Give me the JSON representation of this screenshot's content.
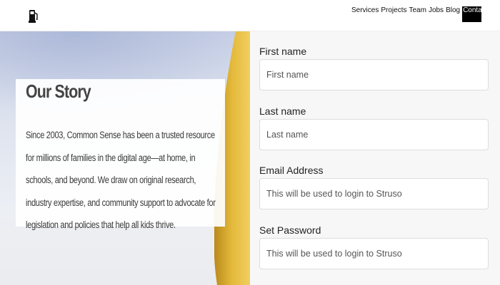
{
  "header": {
    "logo_icon": "fuel-pump-icon",
    "nav": [
      "Services",
      "Projects",
      "Team",
      "Jobs",
      "Blog",
      "Contact"
    ],
    "active_nav": "Contact"
  },
  "story": {
    "title": "Our Story",
    "body": "Since 2003, Common Sense has been a trusted resource for millions of families in the digital age—at home, in schools, and beyond. We draw on original research, industry expertise, and community support to advocate for legislation and policies that help all kids thrive."
  },
  "form": {
    "first_name": {
      "label": "First name",
      "placeholder": "First name"
    },
    "last_name": {
      "label": "Last name",
      "placeholder": "Last name"
    },
    "email": {
      "label": "Email Address",
      "placeholder": "This will be used to login to Struso"
    },
    "password": {
      "label": "Set Password",
      "placeholder": "This will be used to login to Struso"
    }
  },
  "colors": {
    "accent": "#000000",
    "hero_gold": "#d4a72c",
    "form_bg": "#f7f7f7"
  }
}
